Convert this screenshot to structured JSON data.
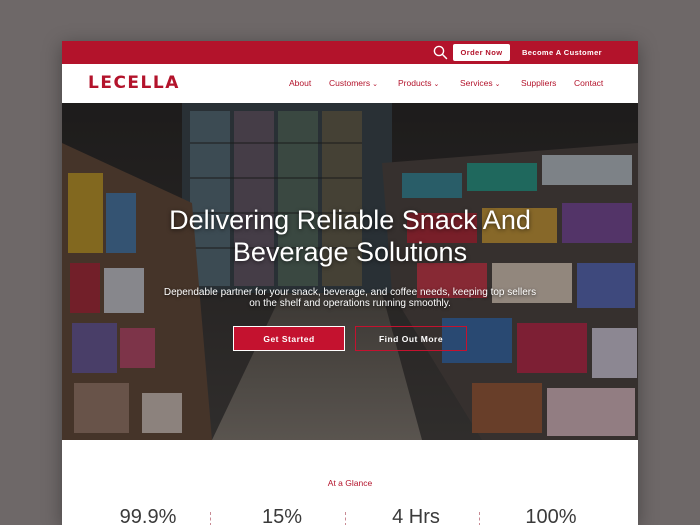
{
  "topbar": {
    "order_now": "Order Now",
    "become_customer": "Become A Customer"
  },
  "header": {
    "logo": "LECELLA",
    "nav": [
      {
        "label": "About",
        "has_dropdown": false
      },
      {
        "label": "Customers",
        "has_dropdown": true
      },
      {
        "label": "Products",
        "has_dropdown": true
      },
      {
        "label": "Services",
        "has_dropdown": true
      },
      {
        "label": "Suppliers",
        "has_dropdown": false
      },
      {
        "label": "Contact",
        "has_dropdown": false
      }
    ]
  },
  "hero": {
    "title_line1": "Delivering Reliable Snack And",
    "title_line2": "Beverage Solutions",
    "subtitle": "Dependable partner for your snack, beverage, and coffee needs, keeping top sellers on the shelf and operations running smoothly.",
    "primary_cta": "Get Started",
    "secondary_cta": "Find Out More"
  },
  "glance": {
    "heading": "At a Glance",
    "stats": [
      "99.9%",
      "15%",
      "4 Hrs",
      "100%"
    ]
  },
  "colors": {
    "brand_red": "#b3132b",
    "background": "#6e6868"
  },
  "icons": {
    "search": "search-icon",
    "dropdown": "chevron-down-icon"
  }
}
